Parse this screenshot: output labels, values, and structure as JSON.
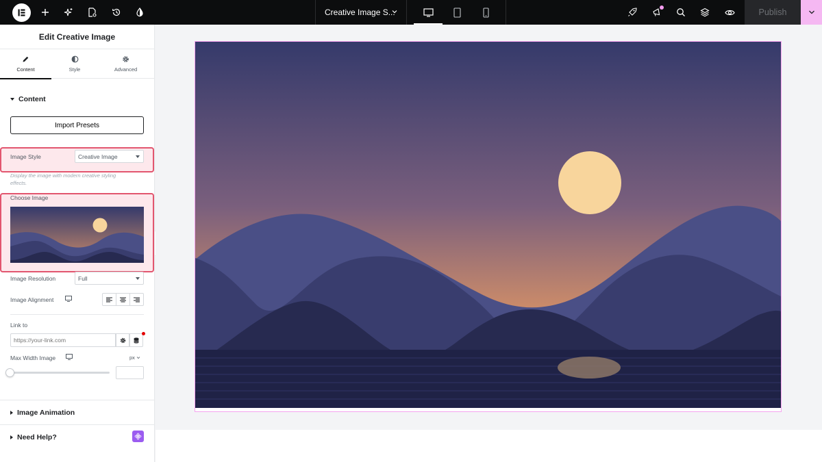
{
  "topbar": {
    "document_title": "Creative Image S...",
    "publish_label": "Publish",
    "icons": [
      "elementor-logo-icon",
      "plus-icon",
      "sparkle-icon",
      "page-settings-icon",
      "history-icon",
      "color-drop-icon",
      "rocket-icon",
      "megaphone-icon",
      "search-icon",
      "layers-icon",
      "eye-icon"
    ]
  },
  "panel": {
    "title": "Edit Creative Image",
    "tabs": [
      {
        "label": "Content",
        "active": true
      },
      {
        "label": "Style",
        "active": false
      },
      {
        "label": "Advanced",
        "active": false
      }
    ],
    "content_section": "Content",
    "import_presets": "Import Presets",
    "image_style": {
      "label": "Image Style",
      "value": "Creative Image",
      "help": "Display the image with modern creative styling effects."
    },
    "choose_image": {
      "label": "Choose Image"
    },
    "image_resolution": {
      "label": "Image Resolution",
      "value": "Full"
    },
    "image_alignment": {
      "label": "Image Alignment"
    },
    "link_to": {
      "label": "Link to",
      "placeholder": "https://your-link.com"
    },
    "max_width": {
      "label": "Max Width Image",
      "unit": "px",
      "slider_value": 0
    },
    "image_animation_section": "Image Animation",
    "need_help_section": "Need Help?"
  },
  "colors": {
    "sky_top": "#353a6b",
    "sky_bottom": "#c98a6a",
    "sun": "#f8d59c",
    "mountain_back": "#4a4f86",
    "mountain_mid": "#393d6e",
    "mountain_front": "#272a50",
    "water": "#1f2246",
    "highlight": "#e2556e",
    "accent": "#f5a3ef"
  }
}
